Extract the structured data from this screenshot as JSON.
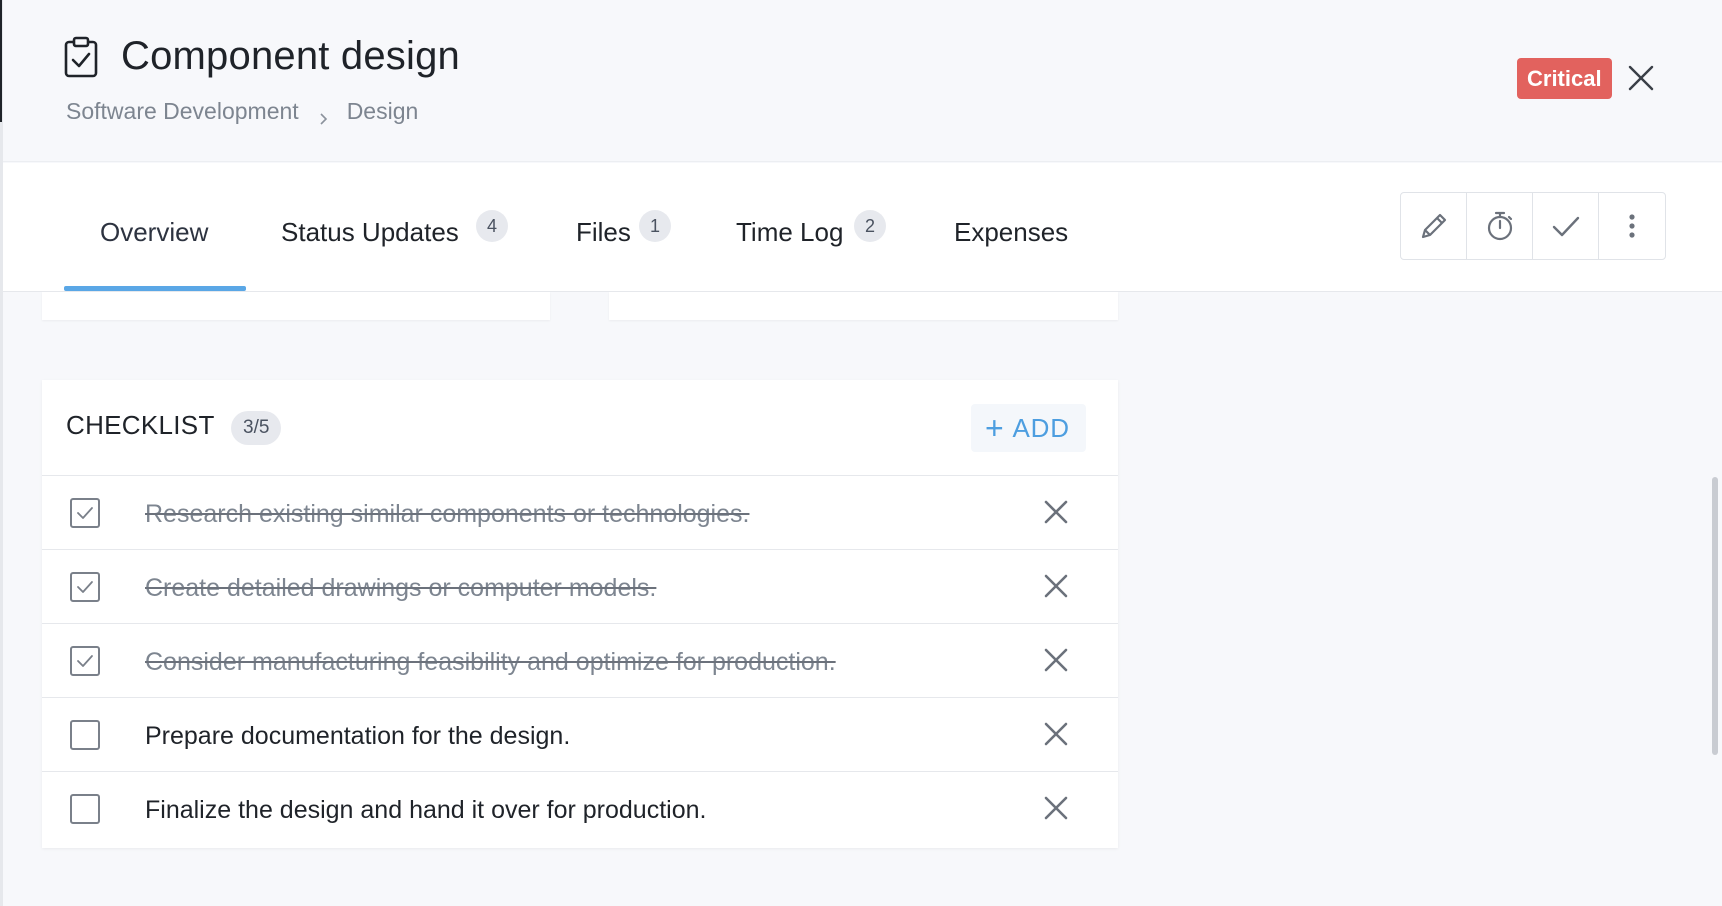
{
  "header": {
    "title": "Component design",
    "breadcrumb": [
      "Software Development",
      "Design"
    ],
    "priority_badge": "Critical"
  },
  "tabs": [
    {
      "label": "Overview",
      "count": null,
      "active": true
    },
    {
      "label": "Status Updates",
      "count": "4",
      "active": false
    },
    {
      "label": "Files",
      "count": "1",
      "active": false
    },
    {
      "label": "Time Log",
      "count": "2",
      "active": false
    },
    {
      "label": "Expenses",
      "count": null,
      "active": false
    }
  ],
  "toolbar": {
    "icons": [
      "pencil-icon",
      "stopwatch-icon",
      "checkmark-icon",
      "more-vertical-icon"
    ]
  },
  "checklist": {
    "title": "CHECKLIST",
    "progress": "3/5",
    "add_label": "ADD",
    "items": [
      {
        "text": "Research existing similar components or technologies.",
        "done": true
      },
      {
        "text": "Create detailed drawings or computer models.",
        "done": true
      },
      {
        "text": "Consider manufacturing feasibility and optimize for production.",
        "done": true
      },
      {
        "text": "Prepare documentation for the design.",
        "done": false
      },
      {
        "text": "Finalize the design and hand it over for production.",
        "done": false
      }
    ]
  },
  "colors": {
    "accent": "#4d9ee0",
    "critical": "#e2625e",
    "tab_underline": "#5aa7e6"
  }
}
